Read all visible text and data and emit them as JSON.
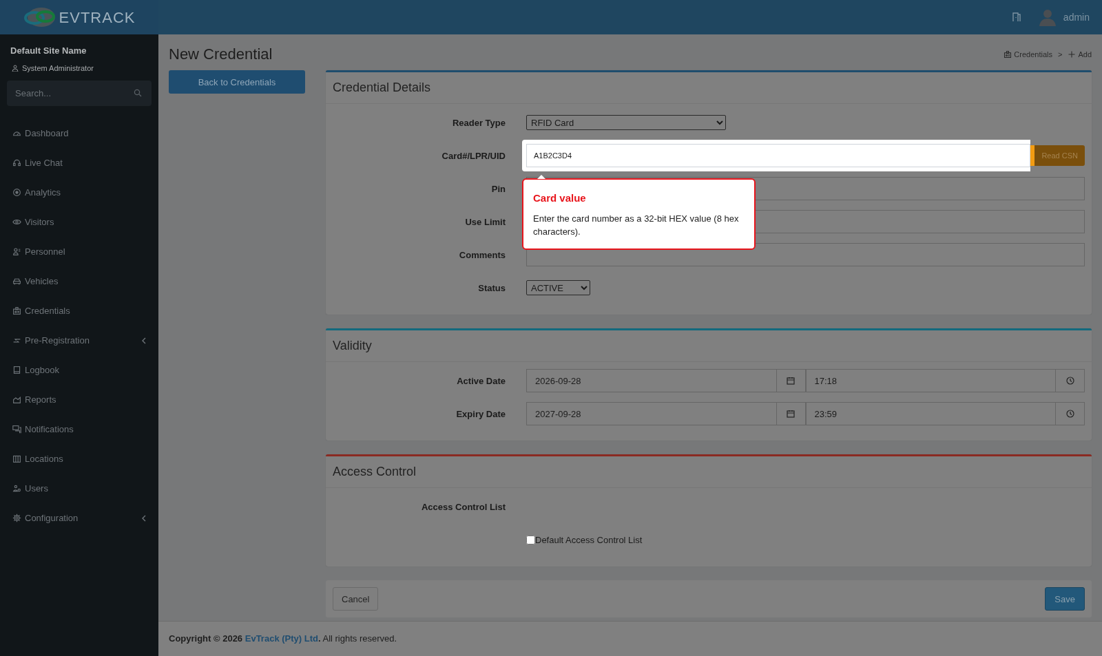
{
  "brand": {
    "logo_text": "**EV**TRACK"
  },
  "topbar": {
    "user": "admin"
  },
  "sidebar": {
    "site": "Default Site Name",
    "role": "System Administrator",
    "search": {
      "placeholder": "Search..."
    },
    "items": [
      {
        "label": "Dashboard",
        "expandable": false
      },
      {
        "label": "Live Chat",
        "expandable": false
      },
      {
        "label": "Analytics",
        "expandable": false
      },
      {
        "label": "Visitors",
        "expandable": false
      },
      {
        "label": "Personnel",
        "expandable": false
      },
      {
        "label": "Vehicles",
        "expandable": false
      },
      {
        "label": "Credentials",
        "expandable": false
      },
      {
        "label": "Pre-Registration",
        "expandable": true
      },
      {
        "label": "Logbook",
        "expandable": false
      },
      {
        "label": "Reports",
        "expandable": false
      },
      {
        "label": "Notifications",
        "expandable": false
      },
      {
        "label": "Locations",
        "expandable": false
      },
      {
        "label": "Users",
        "expandable": false
      },
      {
        "label": "Configuration",
        "expandable": true
      }
    ]
  },
  "page": {
    "title": "New Credential",
    "back_button": "Back to Credentials",
    "breadcrumb": [
      {
        "label": "Credentials"
      },
      {
        "label": "Add"
      }
    ],
    "breadcrumb_separator": ">"
  },
  "sections": [
    {
      "title": "Credential Details",
      "color": "#1f4d6d",
      "fields": [
        {
          "kind": "select",
          "label": "Reader Type",
          "value": "RFID Card"
        },
        {
          "kind": "input-button",
          "label": "Card#/LPR/UID",
          "value": "A1B2C3D4",
          "button": "Read CSN",
          "highlighted": true,
          "tooltip": {
            "title": "Card value",
            "text": "Enter the card number as a 32-bit HEX value (8 hex characters)."
          }
        },
        {
          "kind": "text",
          "label": "Pin"
        },
        {
          "kind": "text",
          "label": "Use Limit"
        },
        {
          "kind": "text",
          "label": "Comments"
        },
        {
          "kind": "select",
          "label": "Status",
          "value": "ACTIVE"
        }
      ]
    },
    {
      "title": "Validity",
      "color": "#136a7e",
      "fields": [
        {
          "kind": "datetime",
          "label": "Active Date",
          "date": "2026-09-28",
          "time": "17:18"
        },
        {
          "kind": "datetime",
          "label": "Expiry Date",
          "date": "2027-09-28",
          "time": "23:59"
        }
      ]
    },
    {
      "title": "Access Control",
      "color": "#8b2a22",
      "fields": [
        {
          "kind": "heading",
          "label": "Access Control List"
        },
        {
          "kind": "checkbox",
          "label": "Default Access Control List",
          "checked": false
        }
      ]
    }
  ],
  "actions": {
    "cancel": "Cancel",
    "save": "Save"
  },
  "footer": {
    "before": "Copyright © 2026",
    "link": "EvTrack (Pty) Ltd",
    "after": "**.** All rights reserved."
  }
}
